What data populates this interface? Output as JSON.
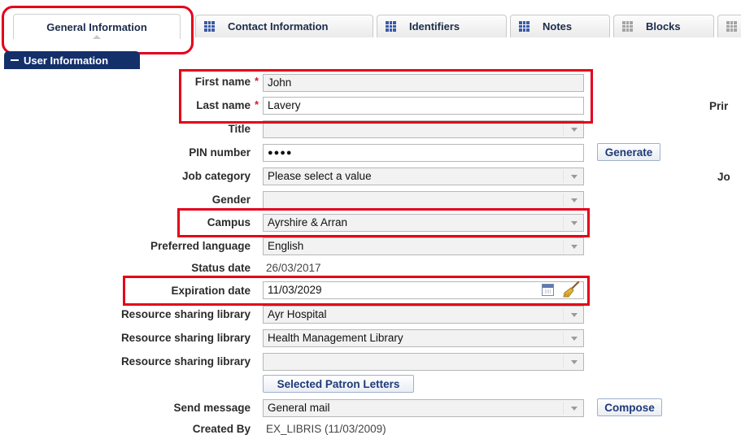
{
  "tabs": [
    {
      "label": "General Information",
      "active": true
    },
    {
      "label": "Contact Information",
      "icon": "grid-icon"
    },
    {
      "label": "Identifiers",
      "icon": "grid-icon"
    },
    {
      "label": "Notes",
      "icon": "grid-icon"
    },
    {
      "label": "Blocks",
      "icon": "grid-icon-gray"
    }
  ],
  "section": {
    "title": "User Information"
  },
  "required_marker": "*",
  "fields": {
    "first_name": {
      "label": "First name",
      "value": "John"
    },
    "last_name": {
      "label": "Last name",
      "value": "Lavery"
    },
    "title": {
      "label": "Title",
      "value": ""
    },
    "pin": {
      "label": "PIN number",
      "value": "●●●●"
    },
    "job_category": {
      "label": "Job category",
      "value": "Please select a value"
    },
    "gender": {
      "label": "Gender",
      "value": ""
    },
    "campus": {
      "label": "Campus",
      "value": "Ayrshire & Arran"
    },
    "preferred_language": {
      "label": "Preferred language",
      "value": "English"
    },
    "status_date": {
      "label": "Status date",
      "value": "26/03/2017"
    },
    "expiration_date": {
      "label": "Expiration date",
      "value": "11/03/2029"
    },
    "rs_library_1": {
      "label": "Resource sharing library",
      "value": "Ayr Hospital"
    },
    "rs_library_2": {
      "label": "Resource sharing library",
      "value": "Health Management Library"
    },
    "rs_library_3": {
      "label": "Resource sharing library",
      "value": ""
    },
    "send_message": {
      "label": "Send message",
      "value": "General mail"
    },
    "created_by": {
      "label": "Created By",
      "value": "EX_LIBRIS (11/03/2009)"
    }
  },
  "buttons": {
    "generate": "Generate",
    "selected_patron_letters": "Selected Patron Letters",
    "compose": "Compose"
  },
  "right_labels": {
    "primary": "Prir",
    "job": "Jo"
  },
  "colors": {
    "accent": "#14306b",
    "highlight": "#e3001b",
    "required": "#d0202a"
  }
}
